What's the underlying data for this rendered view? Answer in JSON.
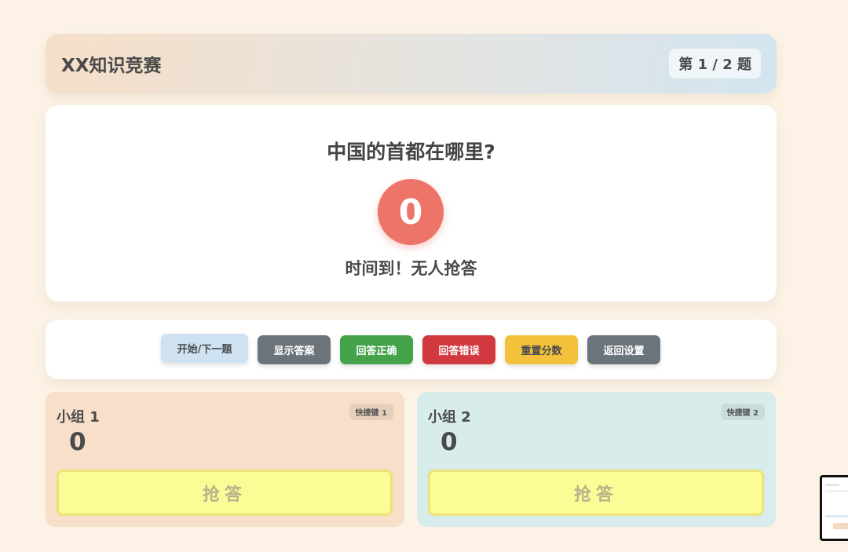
{
  "header": {
    "title": "XX知识竞赛",
    "progress": "第 1 / 2 题"
  },
  "question": {
    "text": "中国的首都在哪里?",
    "timer": "0",
    "status": "时间到！无人抢答"
  },
  "controls": {
    "next": "开始/下一题",
    "show_answer": "显示答案",
    "correct": "回答正确",
    "wrong": "回答错误",
    "reset_score": "重置分数",
    "back_settings": "返回设置"
  },
  "teams": [
    {
      "name": "小组 1",
      "hotkey": "快捷键 1",
      "score": "0",
      "buzz": "抢答",
      "color": "#f8dfc9"
    },
    {
      "name": "小组 2",
      "hotkey": "快捷键 2",
      "score": "0",
      "buzz": "抢答",
      "color": "#d9ecec"
    }
  ],
  "colors": {
    "background": "#fcf3e6",
    "timer": "#ec7468",
    "correct": "#43a24a",
    "wrong": "#d1393f",
    "reset": "#f3c23a",
    "neutral": "#6b737b",
    "buzz": "#fbfc95"
  }
}
